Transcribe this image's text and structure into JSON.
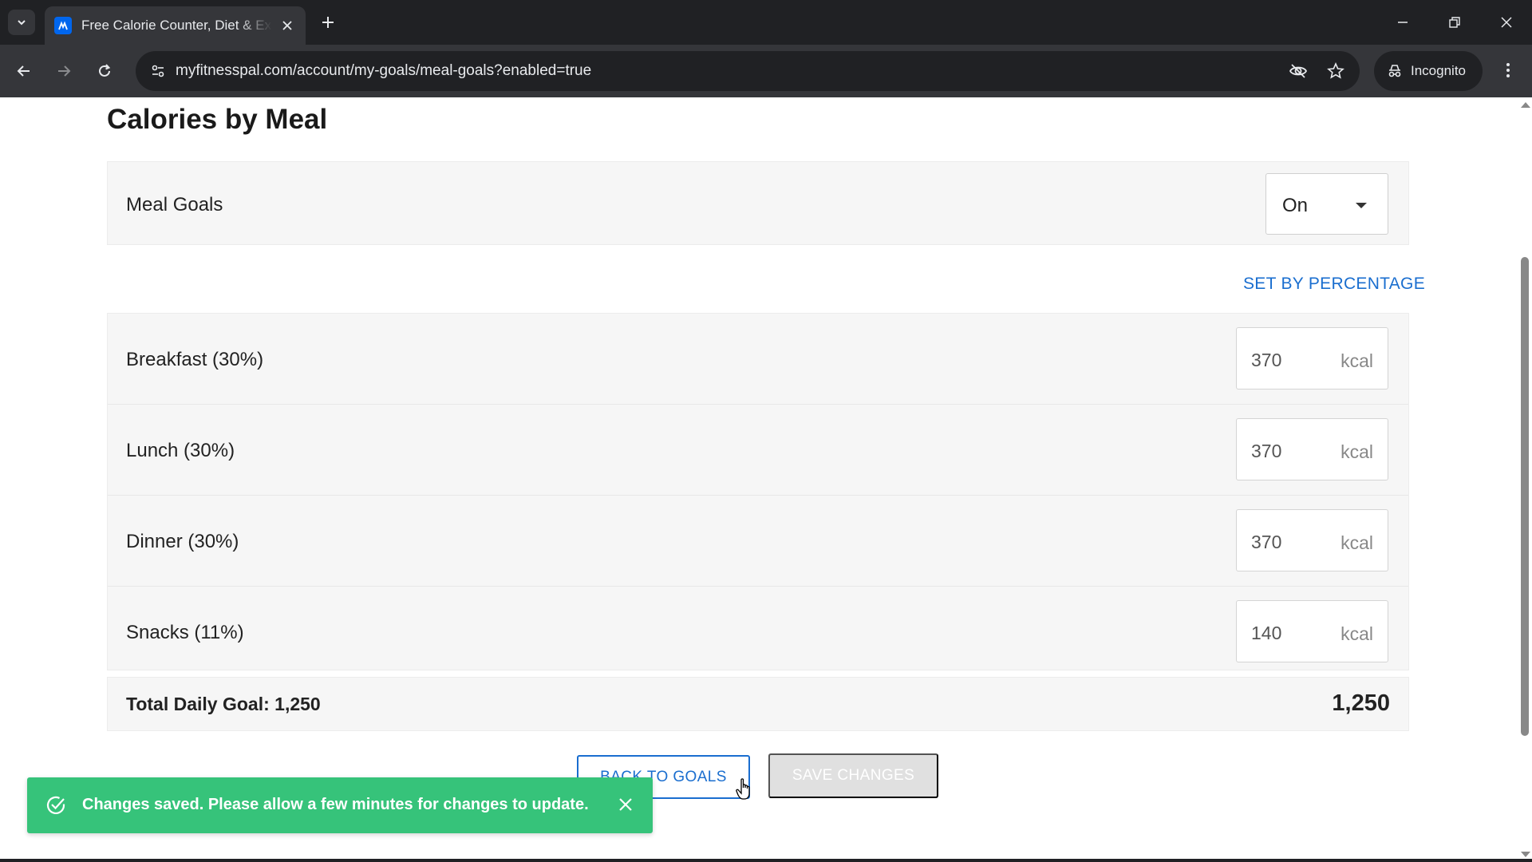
{
  "browser": {
    "tab_title": "Free Calorie Counter, Diet & Exercise",
    "url": "myfitnesspal.com/account/my-goals/meal-goals?enabled=true",
    "incognito_label": "Incognito"
  },
  "page": {
    "title": "Calories by Meal",
    "meal_goals": {
      "label": "Meal Goals",
      "selected": "On"
    },
    "set_by_percentage": "SET BY PERCENTAGE",
    "meals": [
      {
        "label": "Breakfast (30%)",
        "value": "370",
        "unit": "kcal"
      },
      {
        "label": "Lunch (30%)",
        "value": "370",
        "unit": "kcal"
      },
      {
        "label": "Dinner (30%)",
        "value": "370",
        "unit": "kcal"
      },
      {
        "label": "Snacks (11%)",
        "value": "140",
        "unit": "kcal"
      }
    ],
    "total": {
      "label": "Total Daily Goal: 1,250",
      "value": "1,250"
    },
    "buttons": {
      "back": "BACK TO GOALS",
      "save": "SAVE CHANGES"
    },
    "toast": {
      "message": "Changes saved. Please allow a few minutes for changes to update."
    }
  },
  "colors": {
    "accent_blue": "#1a6ecf",
    "toast_green": "#36c37a",
    "chrome_dark": "#202124"
  }
}
